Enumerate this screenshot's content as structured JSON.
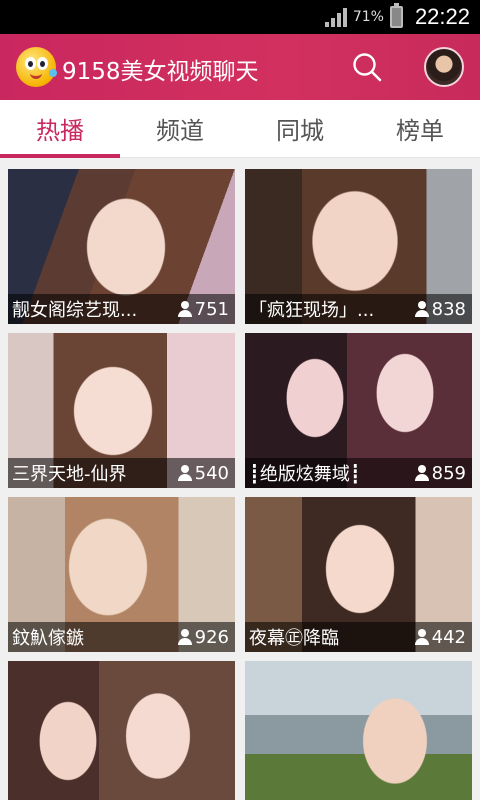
{
  "status_bar": {
    "battery_percent": "71%",
    "time": "22:22"
  },
  "header": {
    "title": "9158美女视频聊天",
    "logo_icon": "smiley-face-logo",
    "search_icon": "search-icon",
    "avatar_icon": "user-avatar"
  },
  "tabs": [
    {
      "label": "热播",
      "active": true
    },
    {
      "label": "频道",
      "active": false
    },
    {
      "label": "同城",
      "active": false
    },
    {
      "label": "榜单",
      "active": false
    }
  ],
  "rooms": [
    {
      "title": "靓女阁综艺现...",
      "viewers": "751"
    },
    {
      "title": "「疯狂现场」...",
      "viewers": "838"
    },
    {
      "title": "三界天地-仙界",
      "viewers": "540"
    },
    {
      "title": "┋绝版炫舞域┋",
      "viewers": "859"
    },
    {
      "title": "鈫魞傢鏃",
      "viewers": "926"
    },
    {
      "title": "夜幕㊣降臨",
      "viewers": "442"
    },
    {
      "title": "",
      "viewers": ""
    },
    {
      "title": "",
      "viewers": ""
    }
  ],
  "colors": {
    "header_bg": "#c9275f",
    "accent": "#c8285d",
    "tab_text": "#555555",
    "caption_bg": "rgba(0,0,0,0.55)"
  }
}
